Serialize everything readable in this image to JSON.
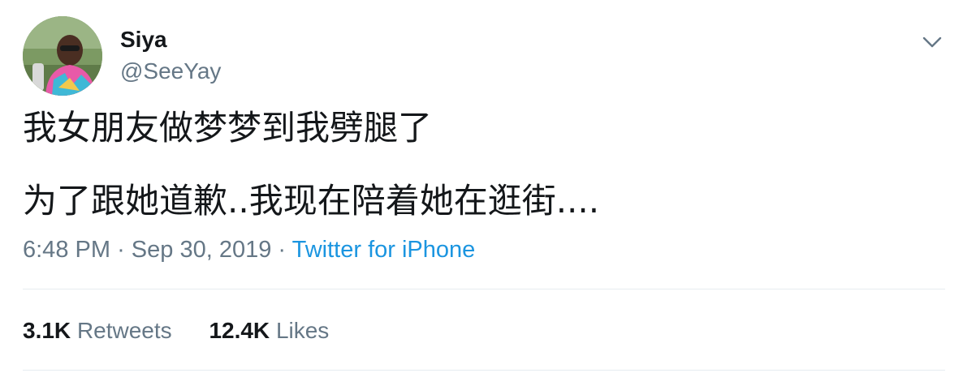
{
  "user": {
    "display_name": "Siya",
    "handle": "@SeeYay"
  },
  "tweet": {
    "lines": [
      "我女朋友做梦梦到我劈腿了",
      "为了跟她道歉..我现在陪着她在逛街...."
    ],
    "time": "6:48 PM",
    "separator": "·",
    "date": "Sep 30, 2019",
    "source": "Twitter for iPhone"
  },
  "stats": {
    "retweets_count": "3.1K",
    "retweets_label": "Retweets",
    "likes_count": "12.4K",
    "likes_label": "Likes"
  },
  "icons": {
    "menu": "chevron-down-icon"
  },
  "colors": {
    "text_primary": "#14171a",
    "text_secondary": "#657786",
    "link": "#1b95e0",
    "divider": "#e6ecf0"
  }
}
